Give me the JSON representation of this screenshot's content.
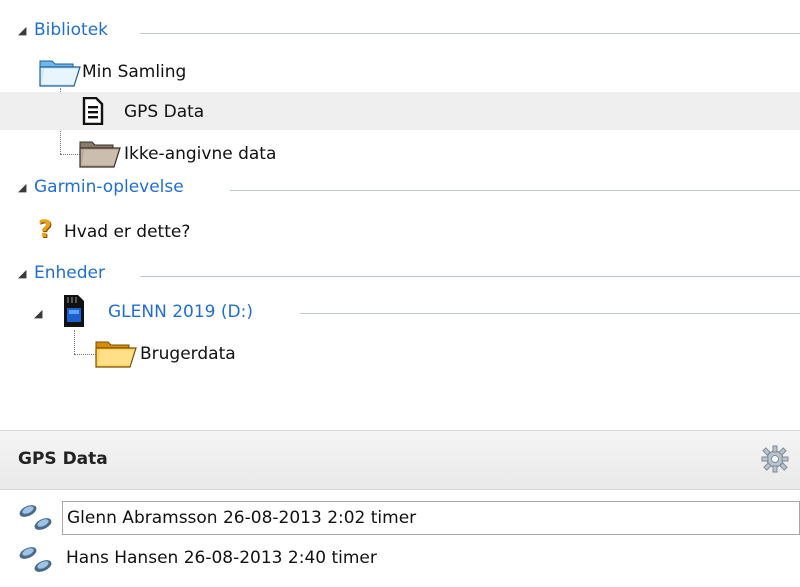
{
  "tree": {
    "sections": [
      {
        "label": "Bibliotek"
      },
      {
        "label": "Garmin-oplevelse"
      },
      {
        "label": "Enheder"
      }
    ],
    "library_root": "Min Samling",
    "library_children": [
      "GPS Data",
      "Ikke-angivne data"
    ],
    "garmin_item": "Hvad er dette?",
    "device_label": "GLENN 2019 (D:)",
    "device_children": [
      "Brugerdata"
    ]
  },
  "panel": {
    "title": "GPS Data",
    "rows": [
      {
        "text": "Glenn Abramsson 26-08-2013 2:02 timer",
        "editing": true
      },
      {
        "text": "Hans Hansen 26-08-2013 2:40 timer",
        "editing": false
      }
    ]
  },
  "colors": {
    "section_label": "#1f6fd0",
    "selection_bg": "#efefef",
    "folder_blue": "#2e8bd6",
    "folder_orange": "#f2a31b"
  }
}
